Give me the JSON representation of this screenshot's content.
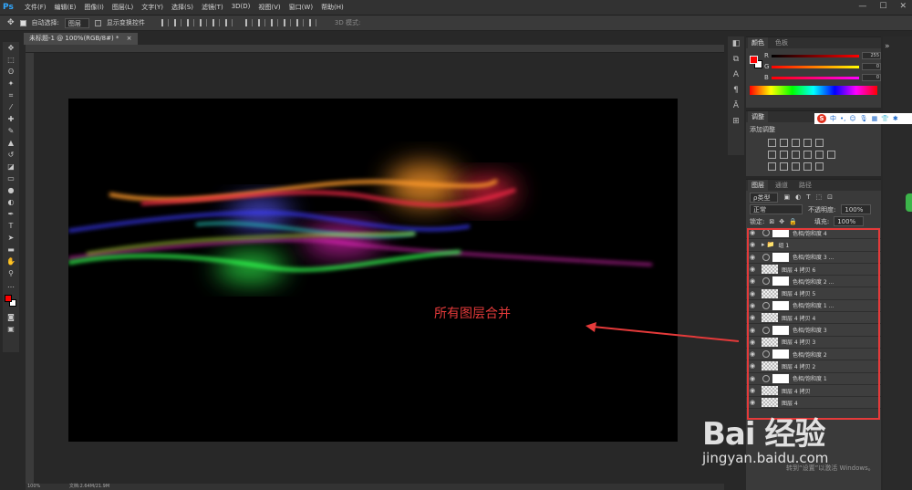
{
  "app": {
    "logo": "Ps"
  },
  "menu": [
    "文件(F)",
    "编辑(E)",
    "图像(I)",
    "图层(L)",
    "文字(Y)",
    "选择(S)",
    "滤镜(T)",
    "3D(D)",
    "视图(V)",
    "窗口(W)",
    "帮助(H)"
  ],
  "window_controls": [
    "—",
    "☐",
    "✕"
  ],
  "options": {
    "auto_select_label": "自动选择:",
    "auto_select_value": "图层",
    "show_transform_label": "显示变换控件",
    "mode_label": "3D 模式:"
  },
  "document": {
    "tab_label": "未标题-1 @ 100%(RGB/8#) *",
    "zoom": "100%",
    "doc_info": "文档:2.64M/21.9M"
  },
  "annotation": {
    "text": "所有图层合并"
  },
  "color_panel": {
    "tabs": [
      "颜色",
      "色板"
    ],
    "r_label": "R",
    "g_label": "G",
    "b_label": "B",
    "r": "255",
    "g": "0",
    "b": "0",
    "fg_color": "#ff0000"
  },
  "adjust_panel": {
    "tabs": [
      "调整"
    ],
    "title": "添加调整"
  },
  "layers_panel": {
    "tabs": [
      "图层",
      "通道",
      "路径"
    ],
    "filter_label": "ρ类型",
    "blend_mode": "正常",
    "opacity_label": "不透明度:",
    "opacity": "100%",
    "lock_label": "锁定:",
    "fill_label": "填充:",
    "fill": "100%",
    "layers": [
      {
        "name": "色相/饱和度 4",
        "kind": "adjust"
      },
      {
        "name": "组 1",
        "kind": "group"
      },
      {
        "name": "色相/饱和度 3 ...",
        "kind": "adjust"
      },
      {
        "name": "图层 4 拷贝 6",
        "kind": "pixel"
      },
      {
        "name": "色相/饱和度 2 ...",
        "kind": "adjust"
      },
      {
        "name": "图层 4 拷贝 5",
        "kind": "pixel"
      },
      {
        "name": "色相/饱和度 1 ...",
        "kind": "adjust"
      },
      {
        "name": "图层 4 拷贝 4",
        "kind": "pixel"
      },
      {
        "name": "色相/饱和度 3",
        "kind": "adjust"
      },
      {
        "name": "图层 4 拷贝 3",
        "kind": "pixel"
      },
      {
        "name": "色相/饱和度 2",
        "kind": "adjust"
      },
      {
        "name": "图层 4 拷贝 2",
        "kind": "pixel"
      },
      {
        "name": "色相/饱和度 1",
        "kind": "adjust"
      },
      {
        "name": "图层 4 拷贝",
        "kind": "pixel"
      },
      {
        "name": "图层 4",
        "kind": "pixel"
      }
    ]
  },
  "ime": {
    "logo": "S",
    "label": "中"
  },
  "watermark": {
    "brand": "Bai  经验",
    "url": "jingyan.baidu.com"
  },
  "activation": {
    "text": "转到“设置”以激活 Windows。"
  },
  "colors": {
    "accent_red": "#e53a3a"
  }
}
